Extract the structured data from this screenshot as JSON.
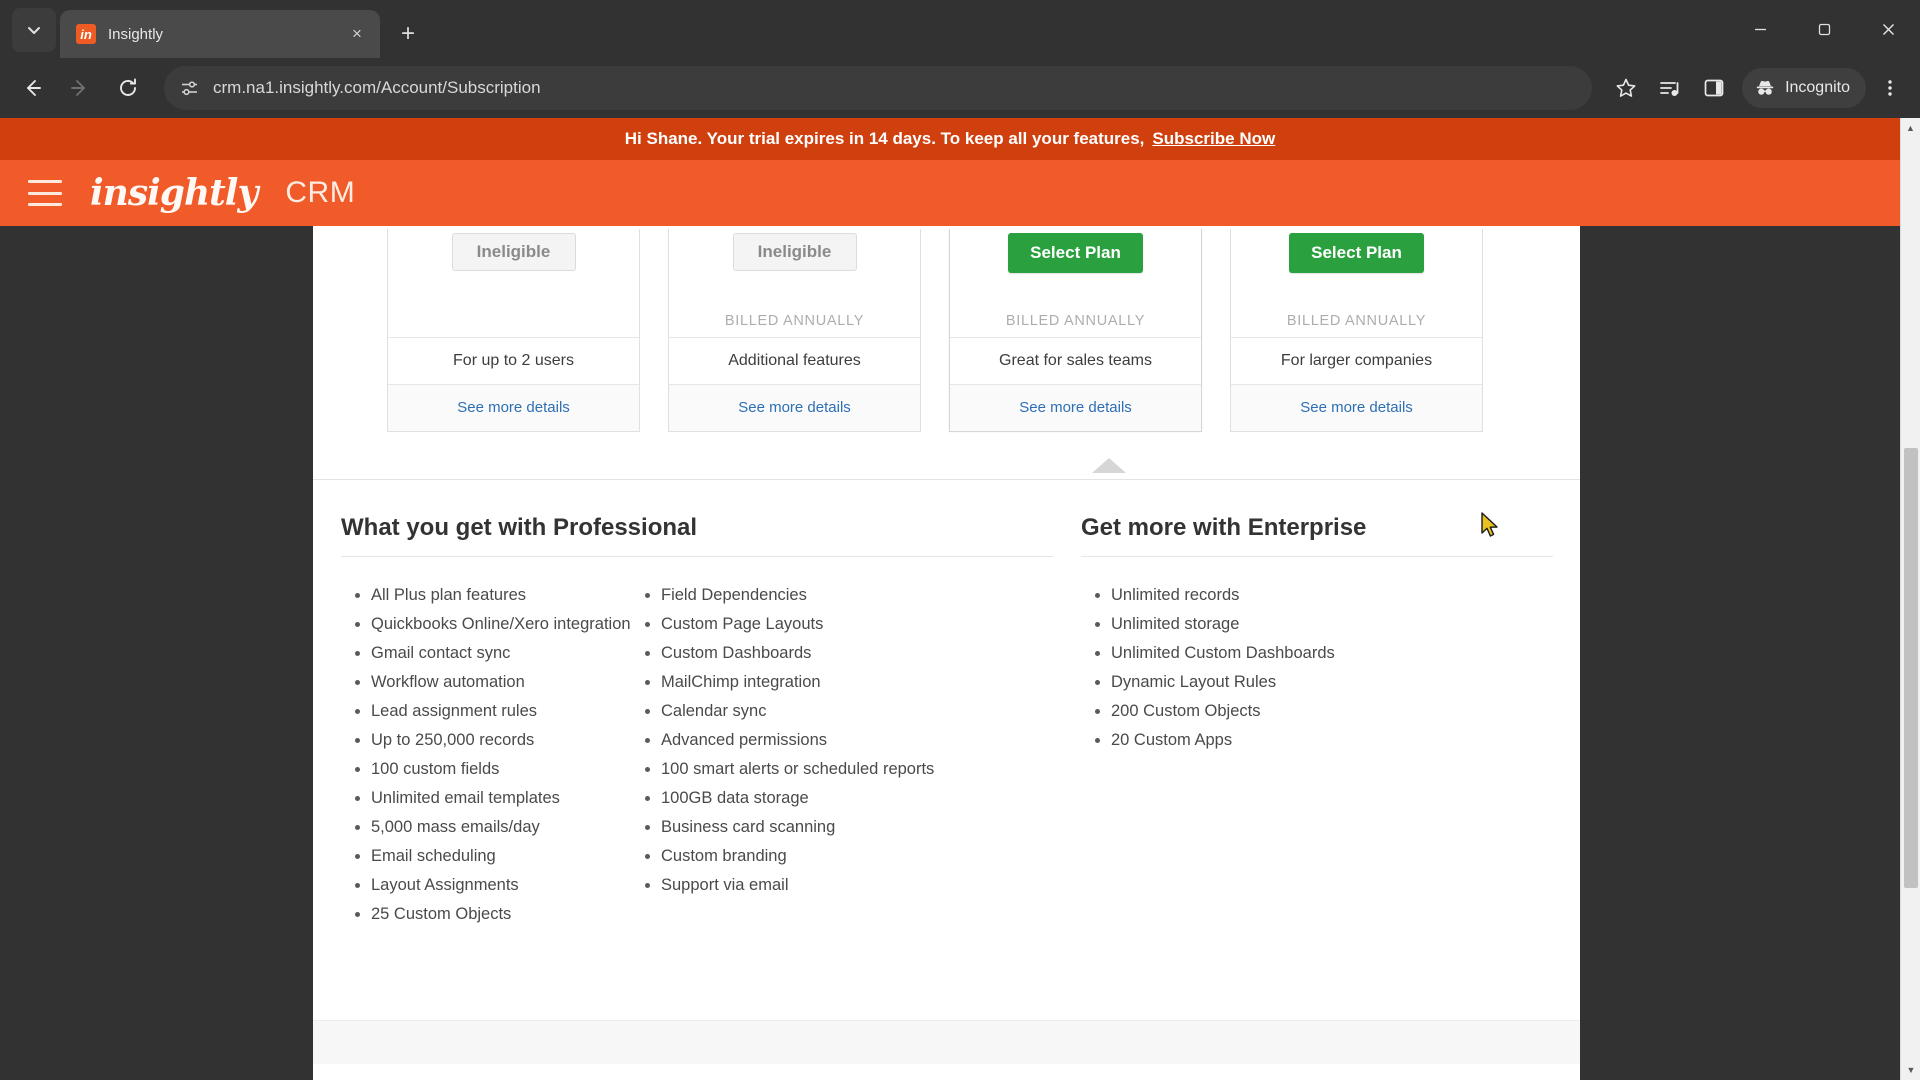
{
  "browser": {
    "tab": {
      "title": "Insightly",
      "favicon_text": "in",
      "favicon_color": "#ef5b25"
    },
    "tab_search_icon": "chevron-down-icon",
    "new_tab_label": "+",
    "close_tab_label": "×",
    "window": {
      "minimize": "—",
      "maximize": "❐",
      "close": "✕"
    },
    "nav": {
      "back": "←",
      "forward": "→",
      "reload": "⟳"
    },
    "omnibox": {
      "url": "crm.na1.insightly.com/Account/Subscription",
      "site_icon": "site-settings-icon"
    },
    "toolbar": {
      "bookmark": "bookmark-star-icon",
      "media": "media-playlist-icon",
      "side_panel": "side-panel-icon",
      "incognito_label": "Incognito",
      "menu": "three-dot-menu-icon"
    }
  },
  "banner": {
    "message": "Hi Shane. Your trial expires in 14 days. To keep all your features,",
    "link": "Subscribe Now",
    "bg_color": "#d0400f"
  },
  "app_header": {
    "brand": "insightly",
    "product": "CRM",
    "bg_color": "#f15a29",
    "menu_icon": "hamburger-menu-icon"
  },
  "plans": [
    {
      "cta": "Ineligible",
      "cta_type": "ineligible",
      "billed": "",
      "tagline": "For up to 2 users",
      "details_link": "See more details"
    },
    {
      "cta": "Ineligible",
      "cta_type": "ineligible",
      "billed": "BILLED ANNUALLY",
      "tagline": "Additional features",
      "details_link": "See more details"
    },
    {
      "cta": "Select Plan",
      "cta_type": "select",
      "billed": "BILLED ANNUALLY",
      "tagline": "Great for sales teams",
      "details_link": "See more details"
    },
    {
      "cta": "Select Plan",
      "cta_type": "select",
      "billed": "BILLED ANNUALLY",
      "tagline": "For larger companies",
      "details_link": "See more details"
    }
  ],
  "select_button_color": "#2aa03f",
  "details": {
    "professional": {
      "title": "What you get with Professional",
      "column_a": [
        "All Plus plan features",
        "Quickbooks Online/Xero integration",
        "Gmail contact sync",
        "Workflow automation",
        "Lead assignment rules",
        "Up to 250,000 records",
        "100 custom fields",
        "Unlimited email templates",
        "5,000 mass emails/day",
        "Email scheduling",
        "Layout Assignments",
        "25 Custom Objects"
      ],
      "column_b": [
        "Field Dependencies",
        "Custom Page Layouts",
        "Custom Dashboards",
        "MailChimp integration",
        "Calendar sync",
        "Advanced permissions",
        "100 smart alerts or scheduled reports",
        "100GB data storage",
        "Business card scanning",
        "Custom branding",
        "Support via email"
      ]
    },
    "enterprise": {
      "title": "Get more with Enterprise",
      "items": [
        "Unlimited records",
        "Unlimited storage",
        "Unlimited Custom Dashboards",
        "Dynamic Layout Rules",
        "200 Custom Objects",
        "20 Custom Apps"
      ]
    }
  },
  "scrollbar": {
    "up_arrow": "▲",
    "down_arrow": "▼"
  }
}
